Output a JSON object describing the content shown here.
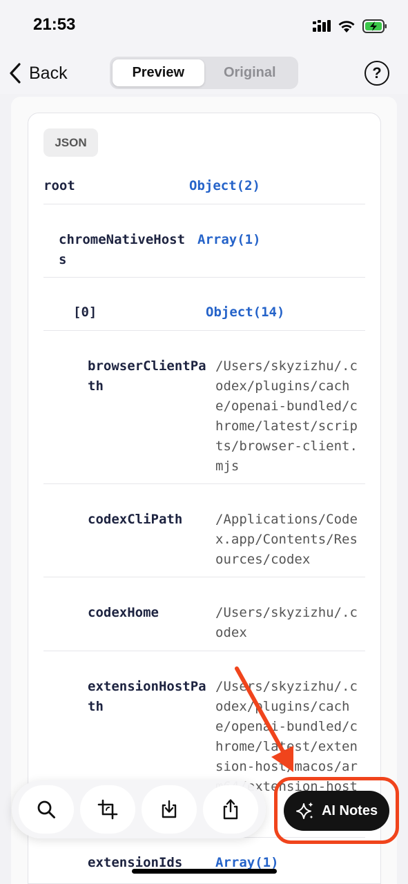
{
  "status": {
    "time": "21:53",
    "icons": [
      "cellular-icon",
      "wifi-icon",
      "battery-charging-icon"
    ]
  },
  "nav": {
    "back_label": "Back",
    "tabs": [
      {
        "label": "Preview",
        "active": true
      },
      {
        "label": "Original",
        "active": false
      }
    ],
    "help_label": "?"
  },
  "viewer": {
    "badge": "JSON",
    "rows": [
      {
        "key": "root",
        "value": "Object(2)",
        "kind": "type"
      },
      {
        "key": "chromeNativeHosts",
        "value": "Array(1)",
        "kind": "type"
      },
      {
        "key": "[0]",
        "value": "Object(14)",
        "kind": "type"
      },
      {
        "key": "browserClientPath",
        "value": "/Users/skyzizhu/.codex/plugins/cache/openai-bundled/chrome/latest/scripts/browser-client.mjs",
        "kind": "str"
      },
      {
        "key": "codexCliPath",
        "value": "/Applications/Codex.app/Contents/Resources/codex",
        "kind": "str"
      },
      {
        "key": "codexHome",
        "value": "/Users/skyzizhu/.codex",
        "kind": "str"
      },
      {
        "key": "extensionHostPath",
        "value": "/Users/skyzizhu/.codex/plugins/cache/openai-bundled/chrome/latest/extension-host/macos/arm64/extension-host",
        "kind": "str"
      },
      {
        "key": "extensionIds",
        "value": "Array(1)",
        "kind": "type"
      }
    ]
  },
  "toolbar": {
    "buttons": [
      "search-icon",
      "crop-icon",
      "download-icon",
      "share-icon"
    ],
    "ai_label": "AI Notes"
  },
  "colors": {
    "accent_blue": "#2563c9",
    "annotation_red": "#f0441c",
    "key_navy": "#1d2340"
  }
}
